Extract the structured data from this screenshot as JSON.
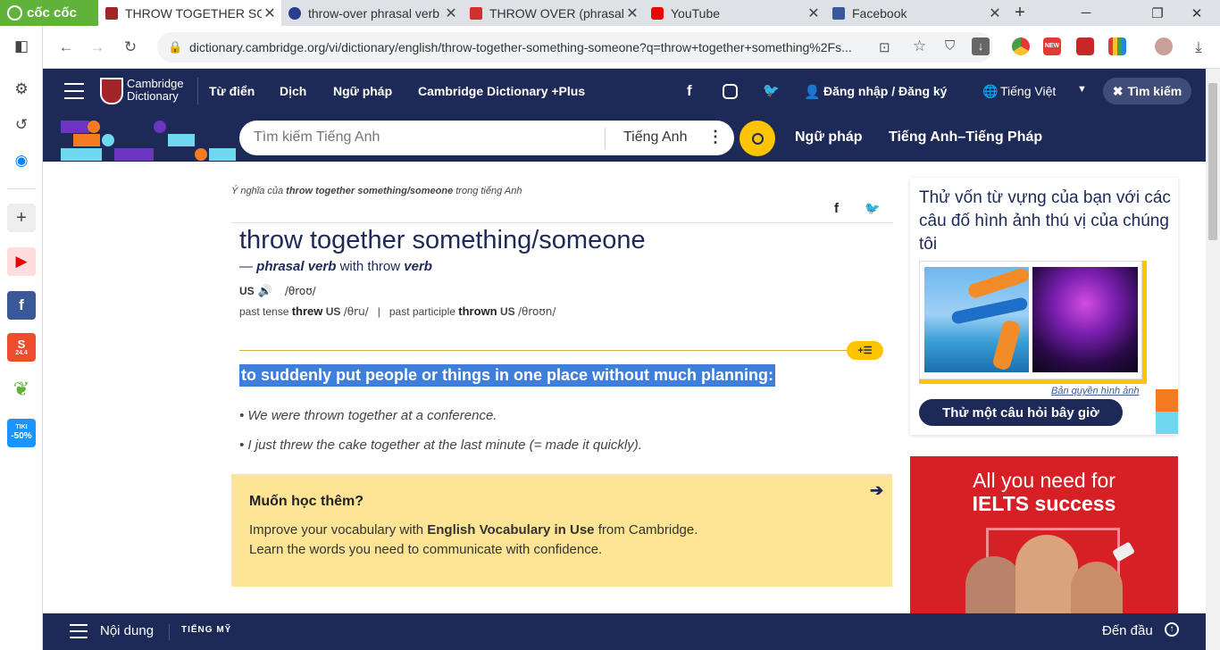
{
  "browser": {
    "brand": "cốc cốc",
    "tabs": [
      {
        "title": "THROW TOGETHER SOMETHING/SOMEONE",
        "favicon": "cambridge-shield-icon",
        "active": true
      },
      {
        "title": "throw-over phrasal verb",
        "favicon": "blue-circle-icon",
        "active": false
      },
      {
        "title": "THROW OVER (phrasal verb)",
        "favicon": "red-book-icon",
        "active": false
      },
      {
        "title": "YouTube",
        "favicon": "youtube-icon",
        "active": false
      },
      {
        "title": "Facebook",
        "favicon": "facebook-icon",
        "active": false
      }
    ],
    "url": "dictionary.cambridge.org/vi/dictionary/english/throw-together-something-someone?q=throw+together+something%2Fs...",
    "sidebar_badges": {
      "shopee": "24.4",
      "tiki_label": "TIKI",
      "tiki_discount": "-50%"
    }
  },
  "site": {
    "logo_line1": "Cambridge",
    "logo_line2": "Dictionary",
    "nav": [
      "Từ điển",
      "Dịch",
      "Ngữ pháp",
      "Cambridge Dictionary +Plus"
    ],
    "login": "Đăng nhập / Đăng ký",
    "language": "Tiếng Việt",
    "search_button": "Tìm kiếm",
    "search_placeholder": "Tìm kiếm Tiếng Anh",
    "search_lang": "Tiếng Anh",
    "subnav": [
      "Ngữ pháp",
      "Tiếng Anh–Tiếng Pháp"
    ]
  },
  "entry": {
    "meaning_prefix": "Ý nghĩa của",
    "meaning_term": "throw together something/someone",
    "meaning_suffix": "trong tiếng Anh",
    "headword": "throw together something/someone",
    "pos_dash": "—",
    "pos": "phrasal verb",
    "pos_with": "with throw",
    "pos_verb": "verb",
    "us_label": "US",
    "pron": "/θroʊ/",
    "past_tense_label": "past tense",
    "past_tense": "threw",
    "past_tense_region": "US",
    "past_tense_pron": "/θru/",
    "sep": "|",
    "past_participle_label": "past participle",
    "past_participle": "thrown",
    "past_participle_region": "US",
    "past_participle_pron": "/θroʊn/",
    "definition": "to suddenly put people or things in one place without much planning:",
    "examples": [
      "We were thrown together at a conference.",
      "I just threw the cake together at the last minute (= made it quickly)."
    ],
    "more_title": "Muốn học thêm?",
    "more_text1_pre": "Improve your vocabulary with ",
    "more_text1_bold": "English Vocabulary in Use",
    "more_text1_post": " from Cambridge.",
    "more_text2": "Learn the words you need to communicate with confidence."
  },
  "quiz": {
    "title": "Thử vốn từ vựng của bạn với các câu đố hình ảnh thú vị của chúng tôi",
    "copyright": "Bản quyền hình ảnh",
    "button": "Thử một câu hỏi bây giờ"
  },
  "ad": {
    "line1": "All you need for",
    "line2": "IELTS success"
  },
  "bottom": {
    "contents": "Nội dung",
    "dialect": "TIẾNG MỸ",
    "top": "Đến đầu"
  }
}
